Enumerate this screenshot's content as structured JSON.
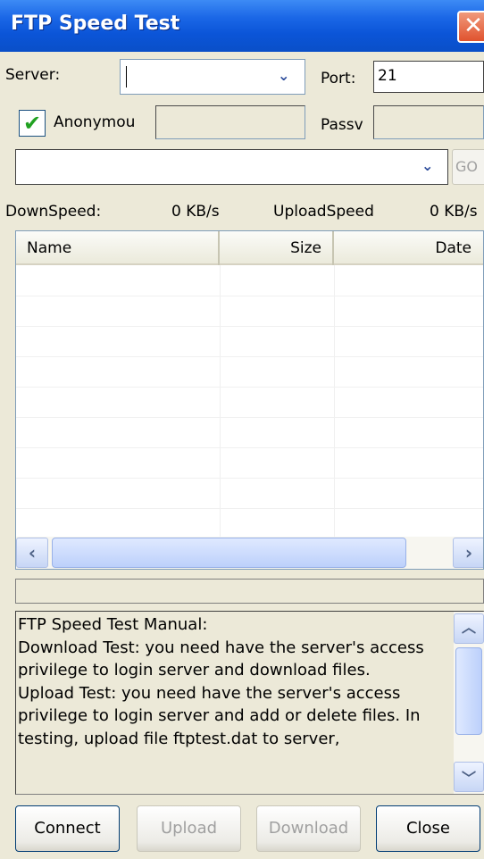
{
  "window": {
    "title": "FTP Speed Test",
    "close_glyph": "✕"
  },
  "server": {
    "label": "Server:",
    "value": "",
    "dropdown_icon": "chevron-down-icon"
  },
  "port": {
    "label": "Port:",
    "value": "21"
  },
  "anonymous": {
    "label": "Anonymou",
    "checked": true,
    "check_glyph": "✔"
  },
  "username": {
    "value": ""
  },
  "passive": {
    "label": "Passv",
    "value": ""
  },
  "path": {
    "value": "",
    "go_label": "GO"
  },
  "speeds": {
    "down_label": "DownSpeed:",
    "down_value": "0 KB/s",
    "up_label": "UploadSpeed",
    "up_value": "0 KB/s"
  },
  "file_list": {
    "columns": [
      "Name",
      "Size",
      "Date"
    ],
    "rows": []
  },
  "scroll": {
    "left_glyph": "‹",
    "right_glyph": "›",
    "up_glyph": "︿",
    "down_glyph": "﹀"
  },
  "manual": {
    "text": "FTP Speed Test Manual:\nDownload Test: you need have the server's access privilege to login server and download files.\nUpload Test: you need have the server's access privilege to login server and add or delete files. In testing, upload file ftptest.dat to server,"
  },
  "buttons": {
    "connect": "Connect",
    "upload": "Upload",
    "download": "Download",
    "close": "Close"
  },
  "colors": {
    "titlebar": "#0b55d8",
    "window_bg": "#ece9d8",
    "check_green": "#21a121",
    "close_red": "#e0522e"
  }
}
